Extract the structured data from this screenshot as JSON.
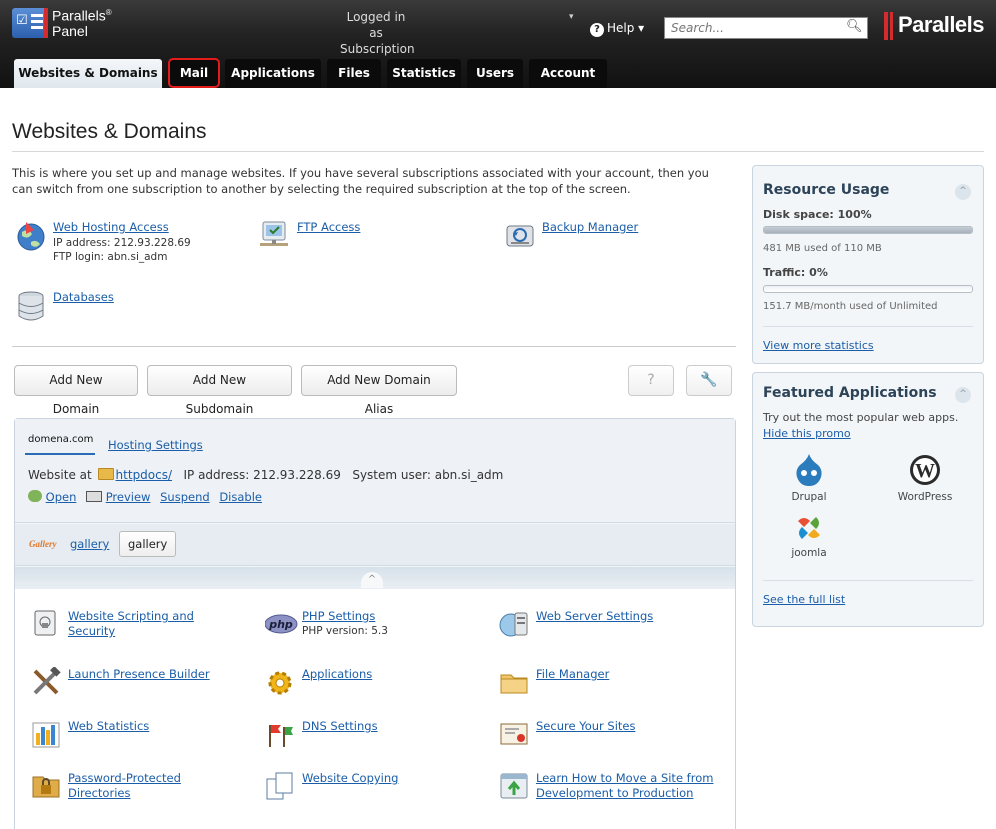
{
  "topbar": {
    "brand_line1": "Parallels",
    "brand_reg": "®",
    "brand_line2": "Panel",
    "login_line1": "Logged in as",
    "login_line2": "Subscription",
    "help_label": "Help ▾",
    "search_placeholder": "Search...",
    "logo_text": "Parallels"
  },
  "tabs": [
    {
      "label": "Websites & Domains",
      "active": true
    },
    {
      "label": "Mail",
      "highlighted": true
    },
    {
      "label": "Applications"
    },
    {
      "label": "Files"
    },
    {
      "label": "Statistics"
    },
    {
      "label": "Users"
    },
    {
      "label": "Account"
    }
  ],
  "main": {
    "title": "Websites & Domains",
    "intro": "This is where you set up and manage websites. If you have several subscriptions associated with your account, then you can switch from one subscription to another by selecting the required subscription at the top of the screen.",
    "quick_items": [
      {
        "label": "Web Hosting Access",
        "lines": [
          "IP address: 212.93.228.69",
          "FTP login: abn.si_adm"
        ]
      },
      {
        "label": "FTP Access"
      },
      {
        "label": "Backup Manager"
      },
      {
        "label": "Databases"
      }
    ],
    "buttons": {
      "add_domain": "Add New Domain",
      "add_subdomain": "Add New Subdomain",
      "add_alias": "Add New Domain Alias",
      "help": "?",
      "tools": "🔧"
    }
  },
  "domain": {
    "name": "domena.com",
    "hosting_settings": "Hosting Settings",
    "website_at": "Website at",
    "docroot": "httpdocs/",
    "ip": "IP address: 212.93.228.69",
    "system_user": "System user: abn.si_adm",
    "actions": {
      "open": "Open",
      "preview": "Preview",
      "suspend": "Suspend",
      "disable": "Disable"
    },
    "gallery_link": "gallery",
    "gallery_button": "gallery",
    "collapse": "^"
  },
  "tools": [
    {
      "label": "Website Scripting and Security"
    },
    {
      "label": "PHP Settings",
      "sub": "PHP version: 5.3",
      "badge": "php"
    },
    {
      "label": "Web Server Settings"
    },
    {
      "label": "Launch Presence Builder"
    },
    {
      "label": "Applications"
    },
    {
      "label": "File Manager"
    },
    {
      "label": "Web Statistics"
    },
    {
      "label": "DNS Settings"
    },
    {
      "label": "Secure Your Sites"
    },
    {
      "label": "Password-Protected Directories"
    },
    {
      "label": "Website Copying"
    },
    {
      "label": "Learn How to Move a Site from Development to Production"
    }
  ],
  "sidebar": {
    "resource": {
      "title": "Resource Usage",
      "disk_label": "Disk space: 100%",
      "disk_fraction": 1.0,
      "disk_detail": "481 MB used of 110 MB",
      "traffic_label": "Traffic: 0%",
      "traffic_fraction": 0.0,
      "traffic_detail": "151.7 MB/month used of Unlimited",
      "more": "View more statistics"
    },
    "featured": {
      "title": "Featured Applications",
      "desc": "Try out the most popular web apps.",
      "hide": "Hide this promo",
      "apps": [
        {
          "name": "Drupal",
          "icon": "drupal-icon"
        },
        {
          "name": "WordPress",
          "icon": "wordpress-icon"
        },
        {
          "name": "joomla",
          "icon": "joomla-icon"
        }
      ],
      "full_list": "See the full list"
    }
  },
  "colors": {
    "accent": "#1a5da8",
    "highlight": "#e31b1b",
    "brand_red": "#d42c2c"
  }
}
